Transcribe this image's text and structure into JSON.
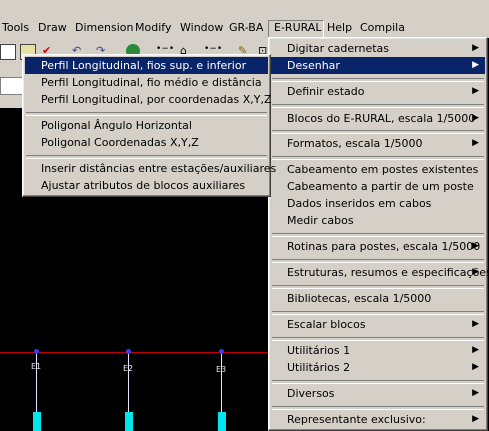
{
  "menubar": {
    "items": [
      "Tools",
      "Draw",
      "Dimension",
      "Modify",
      "Window",
      "GR-BA",
      "E-RURAL",
      "Help",
      "Compila"
    ]
  },
  "erural_menu": {
    "items": [
      {
        "label": "Digitar cadernetas",
        "submenu": true
      },
      {
        "label": "Desenhar",
        "submenu": true
      },
      {
        "label": "Definir estado",
        "submenu": true
      },
      {
        "label": "Blocos do E-RURAL, escala 1/5000",
        "submenu": true
      },
      {
        "label": "Formatos, escala 1/5000",
        "submenu": true
      },
      {
        "label": "Cabeamento em postes existentes",
        "submenu": false
      },
      {
        "label": "Cabeamento a partir de um poste",
        "submenu": false
      },
      {
        "label": "Dados inseridos em cabos",
        "submenu": false
      },
      {
        "label": "Medir cabos",
        "submenu": false
      },
      {
        "label": "Rotinas para postes, escala 1/5000",
        "submenu": true
      },
      {
        "label": "Estruturas, resumos e especificações",
        "submenu": true
      },
      {
        "label": "Bibliotecas, escala 1/5000",
        "submenu": false
      },
      {
        "label": "Escalar blocos",
        "submenu": true
      },
      {
        "label": "Utilitários 1",
        "submenu": true
      },
      {
        "label": "Utilitários 2",
        "submenu": true
      },
      {
        "label": "Diversos",
        "submenu": true
      },
      {
        "label": "Representante exclusivo:",
        "submenu": true
      }
    ]
  },
  "desenhar_menu": {
    "items": [
      "Perfil Longitudinal, fios sup. e inferior",
      "Perfil Longitudinal, fio médio e distância",
      "Perfil Longitudinal, por coordenadas X,Y,Z",
      "Poligonal Ângulo Horizontal",
      "Poligonal Coordenadas X,Y,Z",
      "Inserir distâncias entre estações/auxiliares",
      "Ajustar atributos de blocos auxiliares"
    ]
  },
  "drawing": {
    "pole_labels": [
      "E1",
      "E2",
      "E3"
    ]
  },
  "colors": {
    "menu_bg": "#d4d0c8",
    "highlight": "#0a246a",
    "canvas_bg": "#000000",
    "profile_line": "#c00000"
  }
}
